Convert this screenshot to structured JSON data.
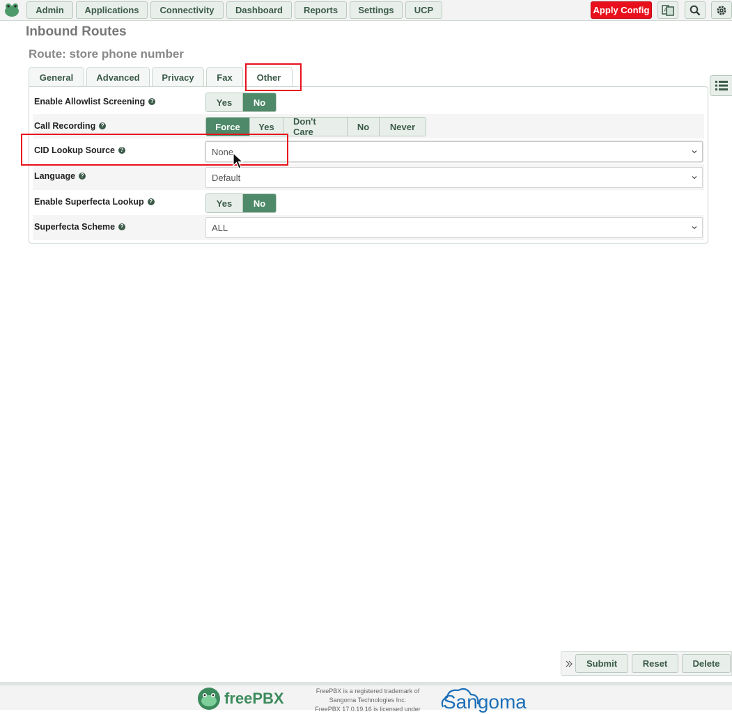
{
  "nav": {
    "items": [
      "Admin",
      "Applications",
      "Connectivity",
      "Dashboard",
      "Reports",
      "Settings",
      "UCP"
    ],
    "apply_config": "Apply Config",
    "icons": [
      "language-icon",
      "search-icon",
      "gear-icon"
    ]
  },
  "page": {
    "title": "Inbound Routes",
    "route_title": "Route: store phone number"
  },
  "tabs": [
    {
      "label": "General",
      "active": false
    },
    {
      "label": "Advanced",
      "active": false
    },
    {
      "label": "Privacy",
      "active": false
    },
    {
      "label": "Fax",
      "active": false
    },
    {
      "label": "Other",
      "active": true
    }
  ],
  "form": {
    "allowlist": {
      "label": "Enable Allowlist Screening",
      "options": [
        "Yes",
        "No"
      ],
      "selected": "No"
    },
    "call_recording": {
      "label": "Call Recording",
      "options": [
        "Force",
        "Yes",
        "Don't Care",
        "No",
        "Never"
      ],
      "selected": "Force"
    },
    "cid_lookup": {
      "label": "CID Lookup Source",
      "value": "None"
    },
    "language": {
      "label": "Language",
      "value": "Default"
    },
    "superfecta_lookup": {
      "label": "Enable Superfecta Lookup",
      "options": [
        "Yes",
        "No"
      ],
      "selected": "No"
    },
    "superfecta_scheme": {
      "label": "Superfecta Scheme",
      "value": "ALL"
    }
  },
  "actions": {
    "submit": "Submit",
    "reset": "Reset",
    "delete": "Delete"
  },
  "footer": {
    "brand": "freePBX",
    "trademark": "FreePBX is a registered trademark of\nSangoma Technologies Inc.\nFreePBX 17.0.19.16 is licensed under",
    "company": "Sangoma"
  },
  "colors": {
    "accent": "#4e8a69",
    "apply": "#e8101c",
    "highlight": "#e8101c"
  }
}
